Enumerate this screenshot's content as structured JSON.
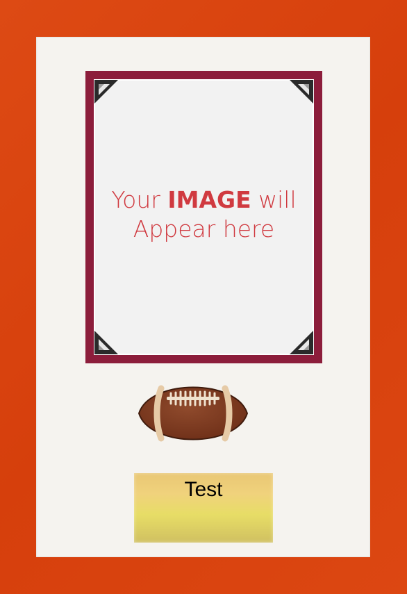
{
  "photo_placeholder": {
    "line1_prefix": "Your",
    "line1_bold": "IMAGE",
    "line1_suffix": "will",
    "line2": "Appear here"
  },
  "plaque": {
    "text": "Test"
  },
  "colors": {
    "frame": "#d9430f",
    "mat": "#f5f3ef",
    "photo_border": "#8c1d3b",
    "placeholder_text": "#d03a40",
    "plaque_gold": "#ecd27a"
  },
  "icons": {
    "corners": "photo-corner-icon",
    "sport": "football-icon"
  }
}
